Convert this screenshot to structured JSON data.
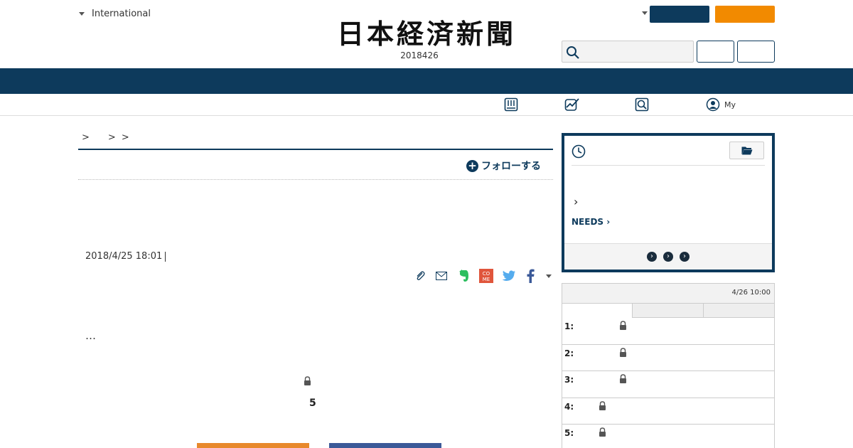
{
  "header": {
    "edition_label": "International",
    "logo_text": "日本経済新聞",
    "date": "2018426",
    "search_placeholder": ""
  },
  "subnav": {
    "items": [
      {
        "icon": "paper-icon",
        "label": ""
      },
      {
        "icon": "chart-icon",
        "label": ""
      },
      {
        "icon": "search-icon",
        "label": ""
      },
      {
        "icon": "user-icon",
        "label": "My"
      }
    ]
  },
  "article": {
    "breadcrumb": [
      ">",
      ">",
      ">"
    ],
    "follow_label": "フォローする",
    "published": "2018/4/25 18:01",
    "ellipsis": "…",
    "count": "5",
    "share_icons": [
      "paperclip-icon",
      "mail-icon",
      "evernote-icon",
      "come-icon",
      "twitter-icon",
      "facebook-icon",
      "more-caret-icon"
    ]
  },
  "sidebar": {
    "panel1": {
      "chevron": "›",
      "needs_label": "NEEDS",
      "dots": [
        "›",
        "›",
        "›"
      ]
    },
    "ranking": {
      "time": "4/26 10:00",
      "rows": [
        {
          "rank": "1:"
        },
        {
          "rank": "2:"
        },
        {
          "rank": "3:"
        },
        {
          "rank": "4:"
        },
        {
          "rank": "5:"
        }
      ]
    }
  },
  "colors": {
    "navy": "#0d3a5c",
    "orange": "#f28a00",
    "facebook": "#3b5998",
    "twitter": "#55acee",
    "evernote": "#2dbe60",
    "come": "#e0553b"
  }
}
